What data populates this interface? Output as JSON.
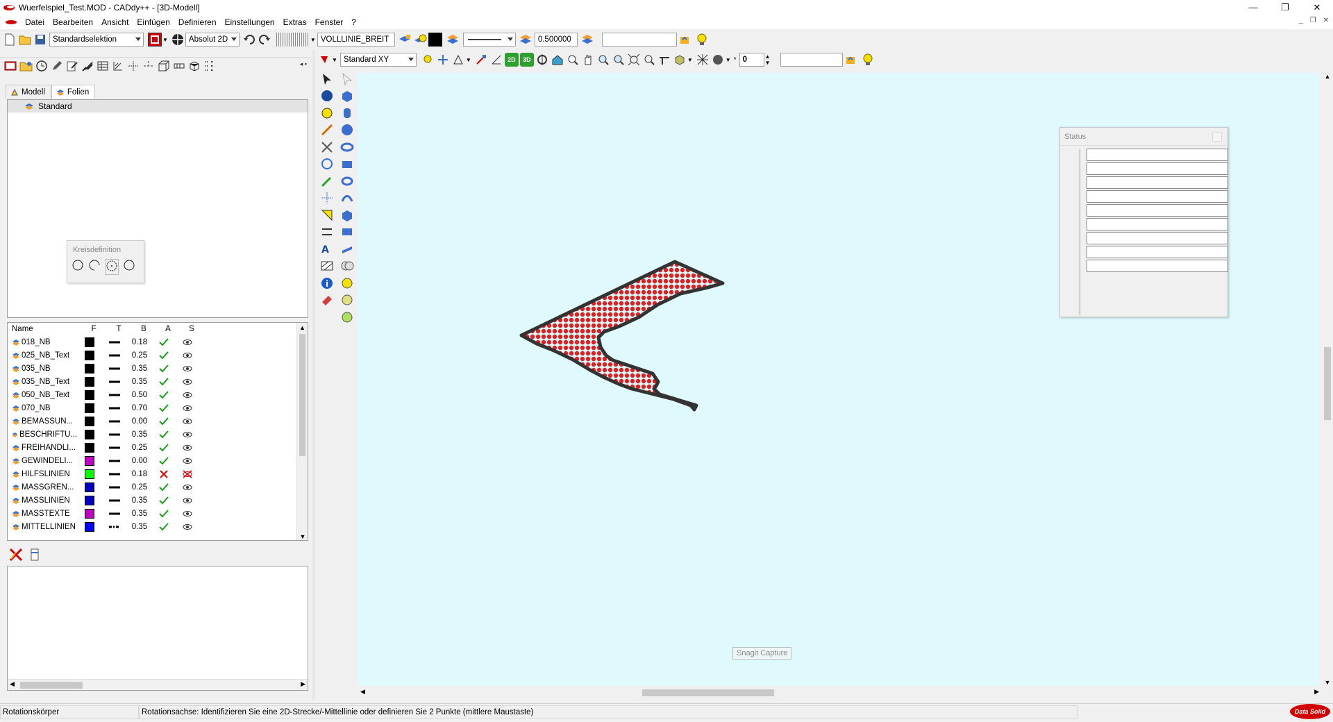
{
  "window": {
    "title": "Wuerfelspiel_Test.MOD  -  CADdy++ - [3D-Modell]",
    "controls": [
      "—",
      "❐",
      "✕"
    ],
    "mdi_controls": [
      "_",
      "❐",
      "✕"
    ]
  },
  "menu": [
    "Datei",
    "Bearbeiten",
    "Ansicht",
    "Einfügen",
    "Definieren",
    "Einstellungen",
    "Extras",
    "Fenster",
    "?"
  ],
  "toolbar_top": {
    "selection_mode": "Standardselektion",
    "coord_mode": "Absolut 2D",
    "linetype_name": "VOLLLINIE_BREIT",
    "line_width_value": "0.500000",
    "search_value": ""
  },
  "toolbar_view": {
    "view_name": "Standard XY",
    "btn_2d": "2D",
    "btn_3d": "3D",
    "counter_value": "0",
    "search_value": ""
  },
  "left_panel": {
    "tabs": [
      {
        "label": "Modell",
        "icon": "model-icon"
      },
      {
        "label": "Folien",
        "icon": "layers-icon"
      }
    ],
    "active_tab": "Folien",
    "tree_selected": "Standard",
    "layer_table": {
      "columns": [
        "Name",
        "F",
        "T",
        "B",
        "A",
        "S"
      ],
      "rows": [
        {
          "name": "018_NB",
          "color": "#000000",
          "linetype": "solid",
          "width": "0.18",
          "active": "check",
          "visible": "eye"
        },
        {
          "name": "025_NB_Text",
          "color": "#000000",
          "linetype": "solid",
          "width": "0.25",
          "active": "check",
          "visible": "eye"
        },
        {
          "name": "035_NB",
          "color": "#000000",
          "linetype": "solid",
          "width": "0.35",
          "active": "check",
          "visible": "eye"
        },
        {
          "name": "035_NB_Text",
          "color": "#000000",
          "linetype": "solid",
          "width": "0.35",
          "active": "check",
          "visible": "eye"
        },
        {
          "name": "050_NB_Text",
          "color": "#000000",
          "linetype": "solid",
          "width": "0.50",
          "active": "check",
          "visible": "eye"
        },
        {
          "name": "070_NB",
          "color": "#000000",
          "linetype": "solid",
          "width": "0.70",
          "active": "check",
          "visible": "eye"
        },
        {
          "name": "BEMASSUN...",
          "color": "#000000",
          "linetype": "solid",
          "width": "0.00",
          "active": "check",
          "visible": "eye"
        },
        {
          "name": "BESCHRIFTU...",
          "color": "#000000",
          "linetype": "solid",
          "width": "0.35",
          "active": "check",
          "visible": "eye"
        },
        {
          "name": "FREIHANDLI...",
          "color": "#000000",
          "linetype": "solid",
          "width": "0.25",
          "active": "check",
          "visible": "eye"
        },
        {
          "name": "GEWINDELI...",
          "color": "#c000c0",
          "linetype": "solid",
          "width": "0.00",
          "active": "check",
          "visible": "eye"
        },
        {
          "name": "HILFSLINIEN",
          "color": "#00ff00",
          "linetype": "solid",
          "width": "0.18",
          "active": "cross",
          "visible": "eye-off"
        },
        {
          "name": "MASSGREN...",
          "color": "#0000c0",
          "linetype": "solid",
          "width": "0.25",
          "active": "check",
          "visible": "eye"
        },
        {
          "name": "MASSLINIEN",
          "color": "#0000c0",
          "linetype": "solid",
          "width": "0.35",
          "active": "check",
          "visible": "eye"
        },
        {
          "name": "MASSTEXTE",
          "color": "#c000c0",
          "linetype": "solid",
          "width": "0.35",
          "active": "check",
          "visible": "eye"
        },
        {
          "name": "MITTELLINIEN",
          "color": "#0000ff",
          "linetype": "dashdot",
          "width": "0.35",
          "active": "check",
          "visible": "eye"
        }
      ]
    }
  },
  "popups": {
    "kreisdefinition": {
      "title": "Kreisdefinition"
    },
    "status": {
      "title": "Status"
    },
    "snagit": "Snagit Capture"
  },
  "statusbar": {
    "left": "Rotationskörper",
    "message": "Rotationsachse: Identifizieren Sie eine 2D-Strecke/-Mittellinie oder definieren Sie 2 Punkte (mittlere Maustaste)",
    "brand": "Data Solid"
  },
  "colors": {
    "canvas_bg": "#e0f9fc",
    "accent_red": "#d00000",
    "hatch_red": "#e02020"
  }
}
